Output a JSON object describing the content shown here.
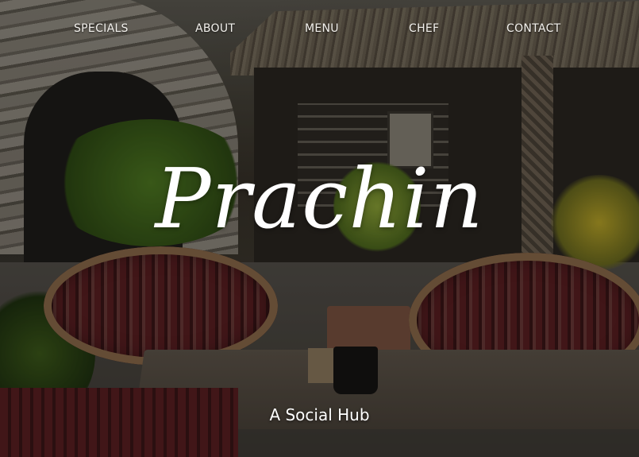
{
  "nav": {
    "items": [
      {
        "label": "SPECIALS"
      },
      {
        "label": "ABOUT"
      },
      {
        "label": "MENU"
      },
      {
        "label": "CHEF"
      },
      {
        "label": "CONTACT"
      }
    ]
  },
  "hero": {
    "brand": "Prachin",
    "tagline": "A Social Hub"
  }
}
